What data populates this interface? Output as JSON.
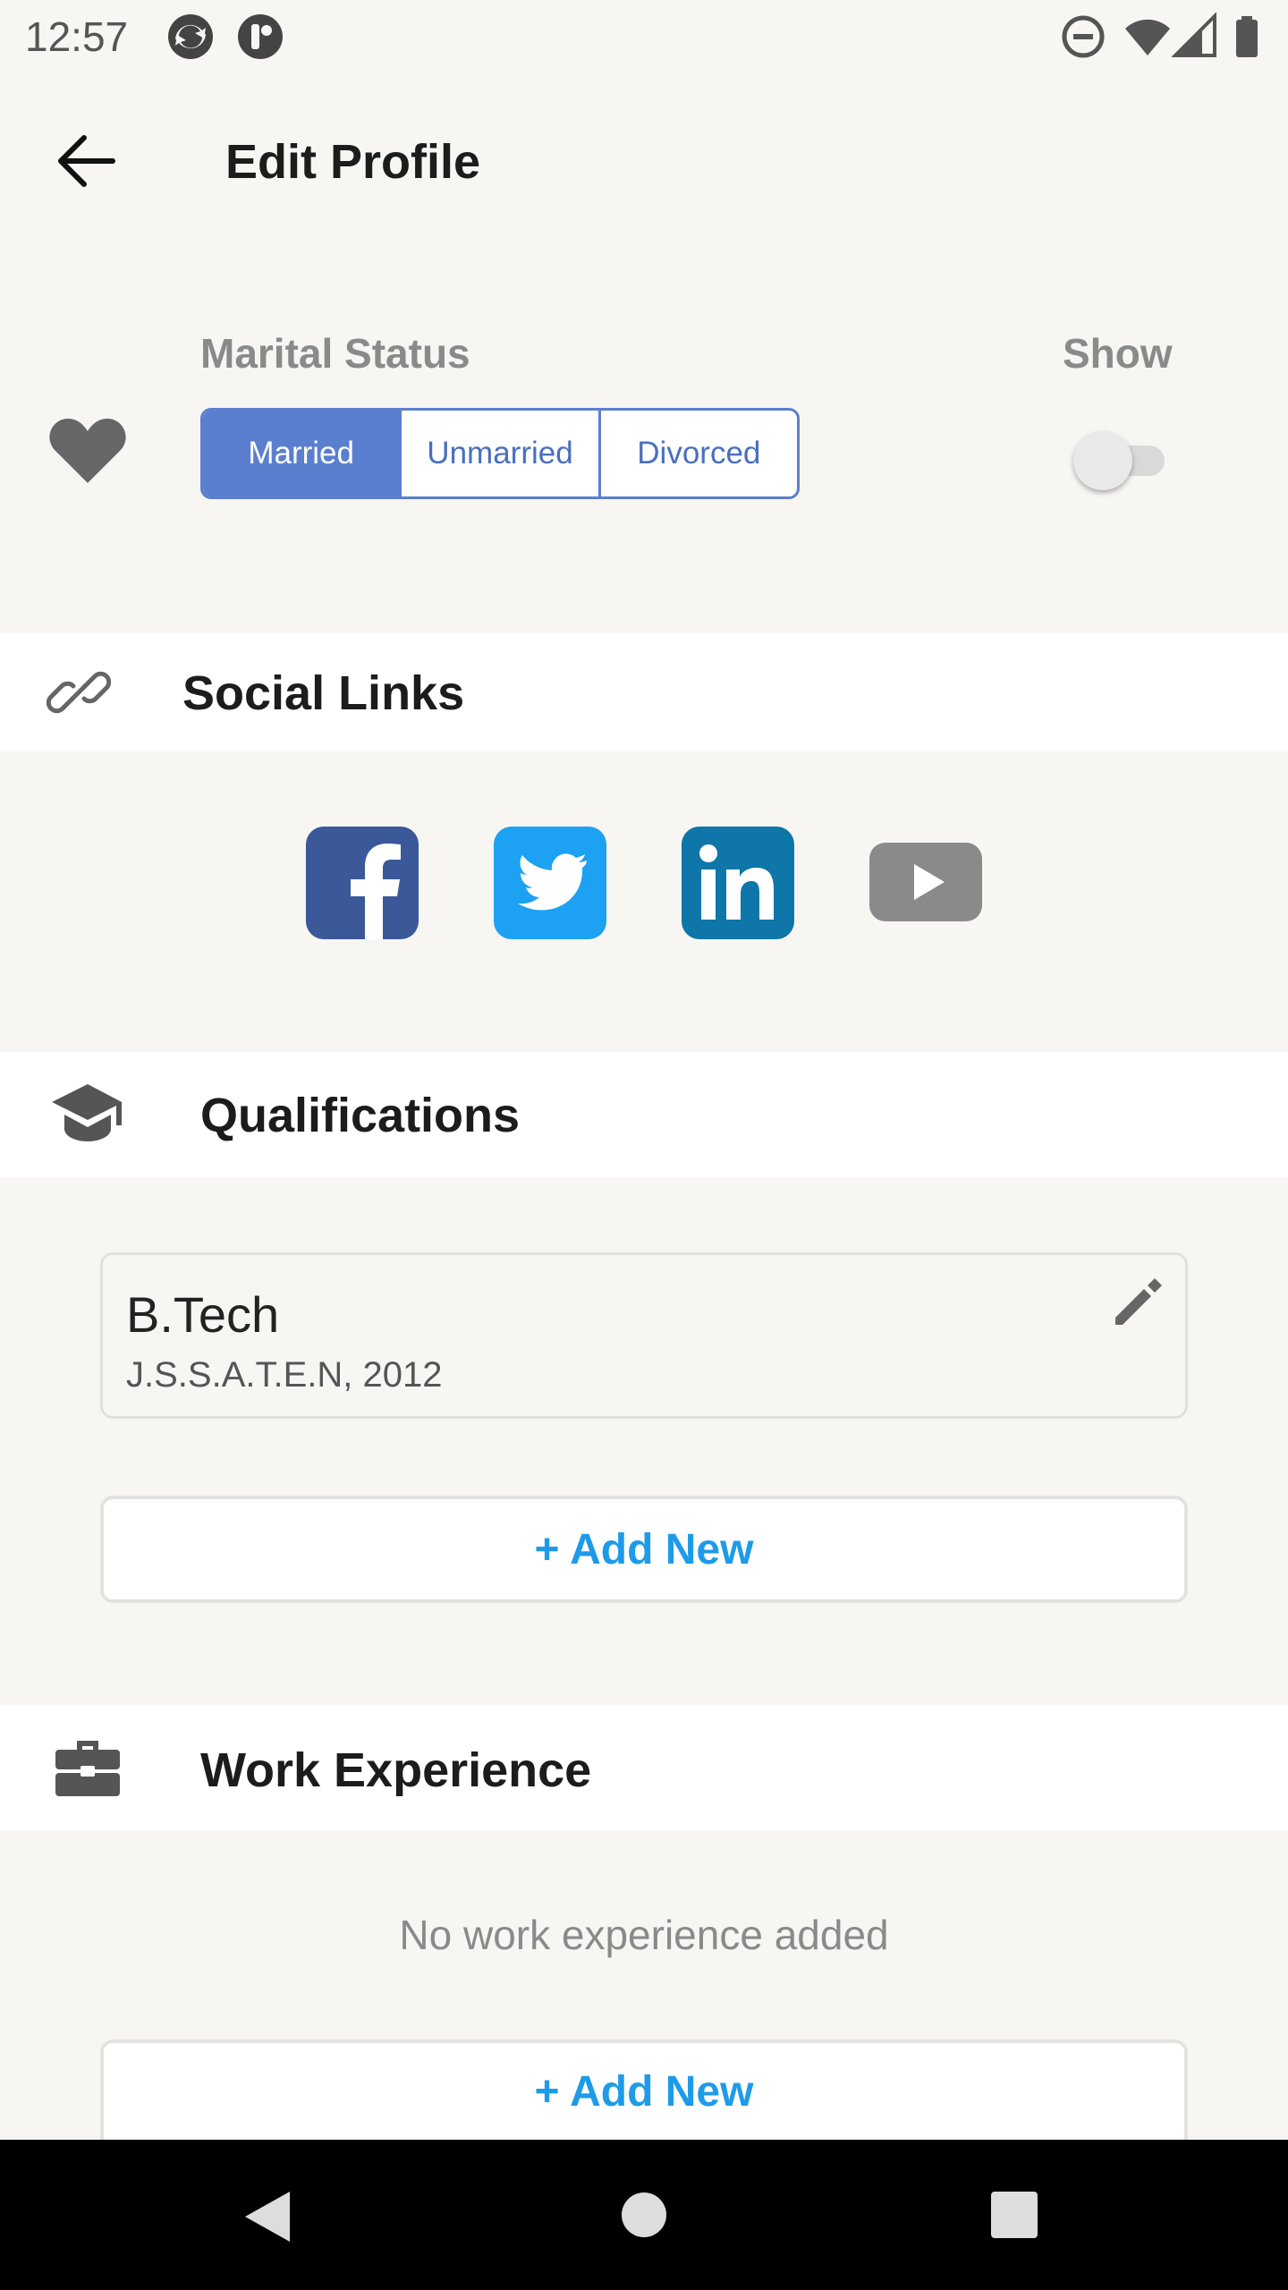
{
  "status_bar": {
    "time": "12:57"
  },
  "header": {
    "title": "Edit Profile"
  },
  "marital": {
    "label": "Marital Status",
    "options": [
      "Married",
      "Unmarried",
      "Divorced"
    ],
    "selected": "Married",
    "show_label": "Show",
    "show_enabled": false
  },
  "social": {
    "title": "Social Links",
    "icons": [
      "facebook-icon",
      "twitter-icon",
      "linkedin-icon",
      "youtube-icon"
    ]
  },
  "qualifications": {
    "title": "Qualifications",
    "items": [
      {
        "degree": "B.Tech",
        "detail": "J.S.S.A.T.E.N, 2012"
      }
    ],
    "add_label": "+ Add New"
  },
  "work": {
    "title": "Work Experience",
    "empty_text": "No work experience added",
    "add_label": "+ Add New"
  },
  "colors": {
    "accent": "#5b7fcf",
    "link": "#1e9be8",
    "facebook": "#3b5998",
    "twitter": "#1da1f2",
    "linkedin": "#0e76a8",
    "youtube": "#8a8a8a"
  }
}
